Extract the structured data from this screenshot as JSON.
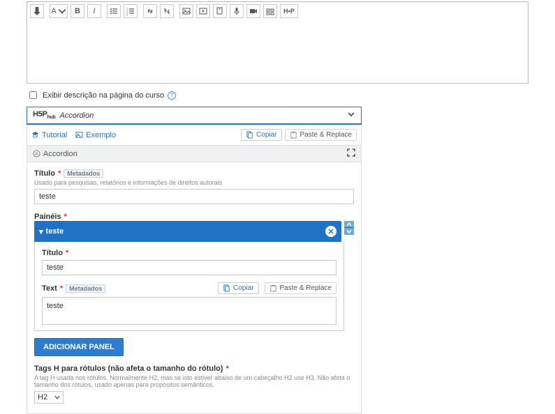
{
  "checkbox_label": "Exibir descrição na página do curso",
  "hub": {
    "logo": "H5P",
    "selected": "Accordion"
  },
  "actions": {
    "tutorial": "Tutorial",
    "example": "Exemplo",
    "copy": "Copiar",
    "paste": "Paste & Replace"
  },
  "grey_header": "Accordion",
  "title": {
    "label": "Título",
    "metadata": "Metadados",
    "desc": "Usado para pesquisas, relatórios e informações de direitos autorais",
    "value": "teste"
  },
  "panels_label": "Painéis",
  "panel": {
    "name": "teste",
    "title_label": "Título",
    "title_value": "teste",
    "text_label": "Text",
    "metadata": "Metadados",
    "copy": "Copiar",
    "paste": "Paste & Replace",
    "text_value": "teste"
  },
  "add_panel": "ADICIONAR PANEL",
  "htag": {
    "label": "Tags H para rótulos (não afeta o tamanho do rótulo)",
    "desc": "A tag H usada nos rótulos. Normalmente H2, mas se isto estiver abaixo de um cabeçalho H2 use H3. Não afeta o tamanho dos rótulos, usado apenas para propósitos semânticos.",
    "value": "H2"
  }
}
